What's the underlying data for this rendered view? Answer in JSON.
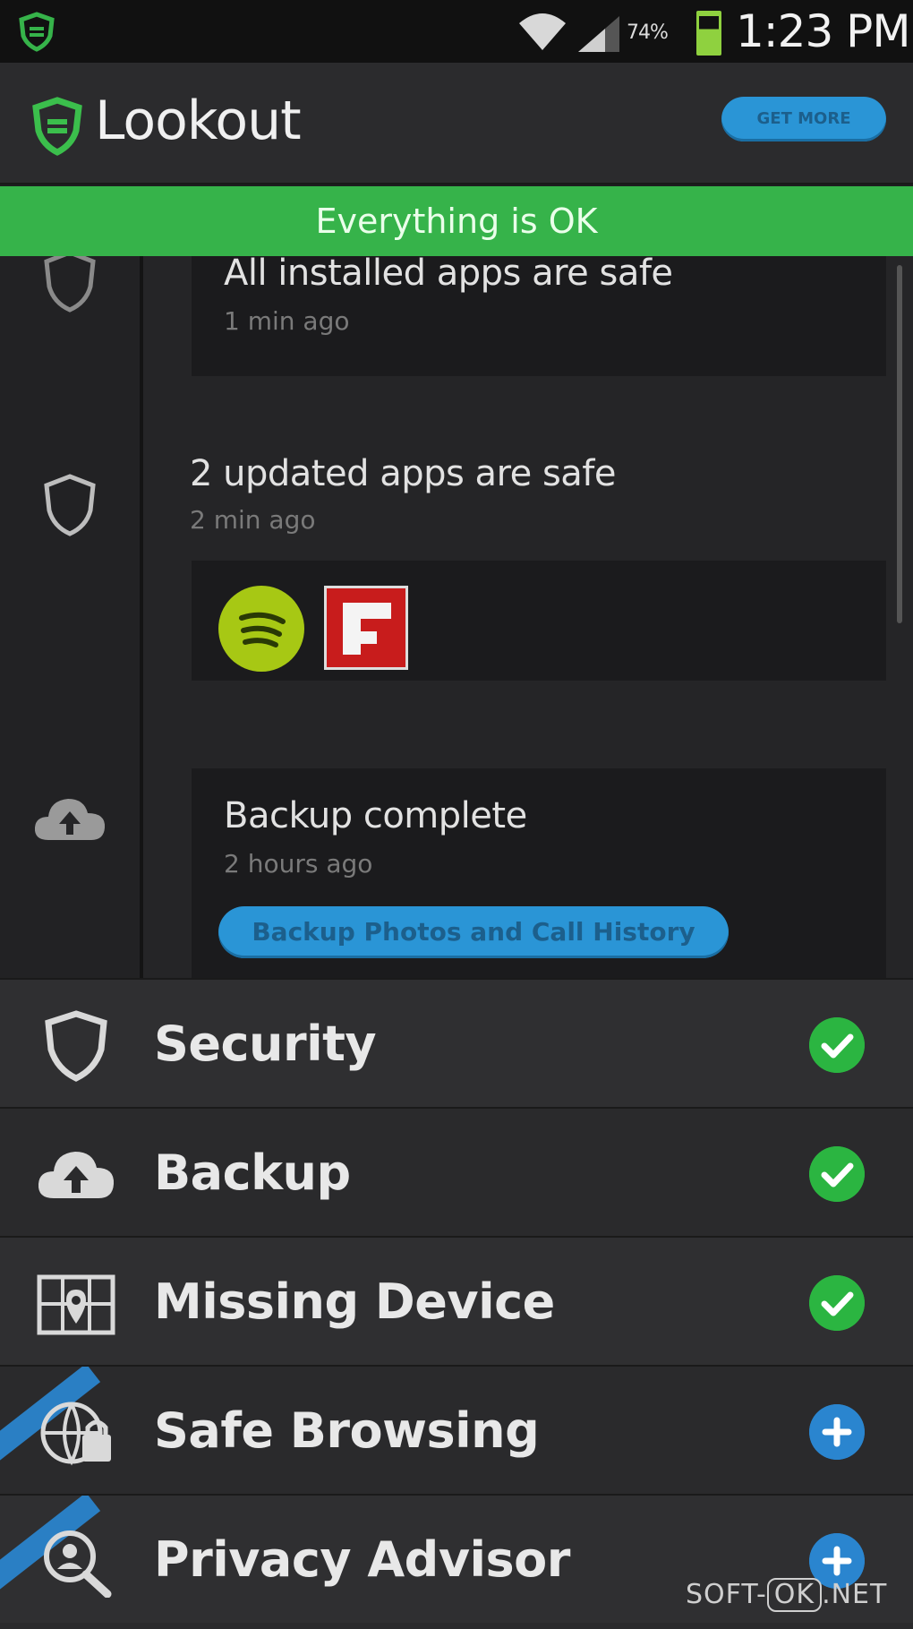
{
  "status_bar": {
    "battery_percent": "74%",
    "time": "1:23 PM"
  },
  "app_bar": {
    "app_name": "Lookout",
    "get_more_label": "GET MORE"
  },
  "status_banner": "Everything is OK",
  "feed": [
    {
      "title": "All installed apps are safe",
      "subtitle": "1 min ago",
      "icon": "shield-icon"
    },
    {
      "title": "2 updated apps are safe",
      "subtitle": "2 min ago",
      "icon": "shield-icon",
      "apps": [
        "spotify-icon",
        "flipboard-icon"
      ]
    },
    {
      "title": "Backup complete",
      "subtitle": "2 hours ago",
      "icon": "cloud-upload-icon",
      "action_label": "Backup Photos and Call History"
    }
  ],
  "menu": [
    {
      "label": "Security",
      "icon": "shield-icon",
      "status": "ok"
    },
    {
      "label": "Backup",
      "icon": "cloud-upload-icon",
      "status": "ok"
    },
    {
      "label": "Missing Device",
      "icon": "map-pin-icon",
      "status": "ok"
    },
    {
      "label": "Safe Browsing",
      "icon": "globe-lock-icon",
      "status": "add",
      "premium": true
    },
    {
      "label": "Privacy Advisor",
      "icon": "magnifier-person-icon",
      "status": "add",
      "premium": true
    }
  ],
  "colors": {
    "accent_green": "#36b34a",
    "accent_blue": "#2a95d6"
  },
  "watermark": {
    "prefix": "SOFT-",
    "boxed": "OK",
    "suffix": ".NET"
  }
}
